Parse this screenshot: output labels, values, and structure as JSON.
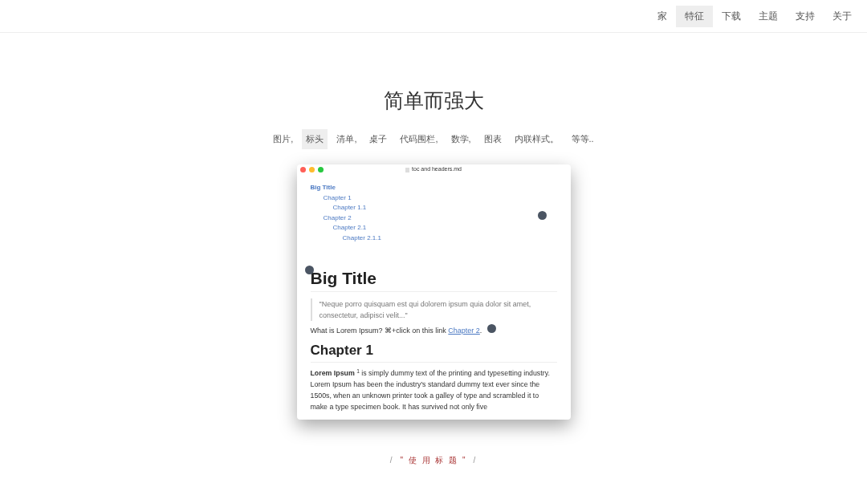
{
  "nav": [
    {
      "label": "家",
      "selected": false
    },
    {
      "label": "特征",
      "selected": true
    },
    {
      "label": "下载",
      "selected": false
    },
    {
      "label": "主题",
      "selected": false
    },
    {
      "label": "支持",
      "selected": false
    },
    {
      "label": "关于",
      "selected": false
    }
  ],
  "heading": "简单而强大",
  "features": [
    {
      "label": "图片,",
      "selected": false
    },
    {
      "label": "标头",
      "selected": true
    },
    {
      "label": "清单,",
      "selected": false
    },
    {
      "label": "桌子",
      "selected": false
    },
    {
      "label": "代码围栏,",
      "selected": false
    },
    {
      "label": "数学,",
      "selected": false
    },
    {
      "label": "图表",
      "selected": false
    },
    {
      "label": "内联样式。",
      "selected": false
    },
    {
      "label": "等等..",
      "selected": false
    }
  ],
  "editor": {
    "title": "toc and headers.md",
    "toc": [
      {
        "label": "Big Title",
        "children": [
          {
            "label": "Chapter 1",
            "children": [
              {
                "label": "Chapter 1.1"
              }
            ]
          },
          {
            "label": "Chapter 2",
            "children": [
              {
                "label": "Chapter 2.1",
                "children": [
                  {
                    "label": "Chapter 2.1.1"
                  }
                ]
              }
            ]
          }
        ]
      }
    ],
    "h1": "Big Title",
    "quote": "\"Neque porro quisquam est qui dolorem ipsum quia dolor sit amet, consectetur, adipisci velit...\"",
    "link_line": {
      "text": "What is Lorem Ipsum? ⌘+click on this link",
      "link": "Chapter 2",
      "suffix": "."
    },
    "h2": "Chapter 1",
    "paragraph": "**Lorem Ipsum** $^{1}$ is simply dummy text of the printing and typesetting industry. Lorem Ipsum has been the industry's standard dummy text ever since the 1500s, when an unknown printer took a galley of type and scrambled it to make a type specimen book. It has survived not only five"
  },
  "caption": {
    "left": "/",
    "text": "\" 使 用 标 题 \"",
    "right": "/"
  }
}
